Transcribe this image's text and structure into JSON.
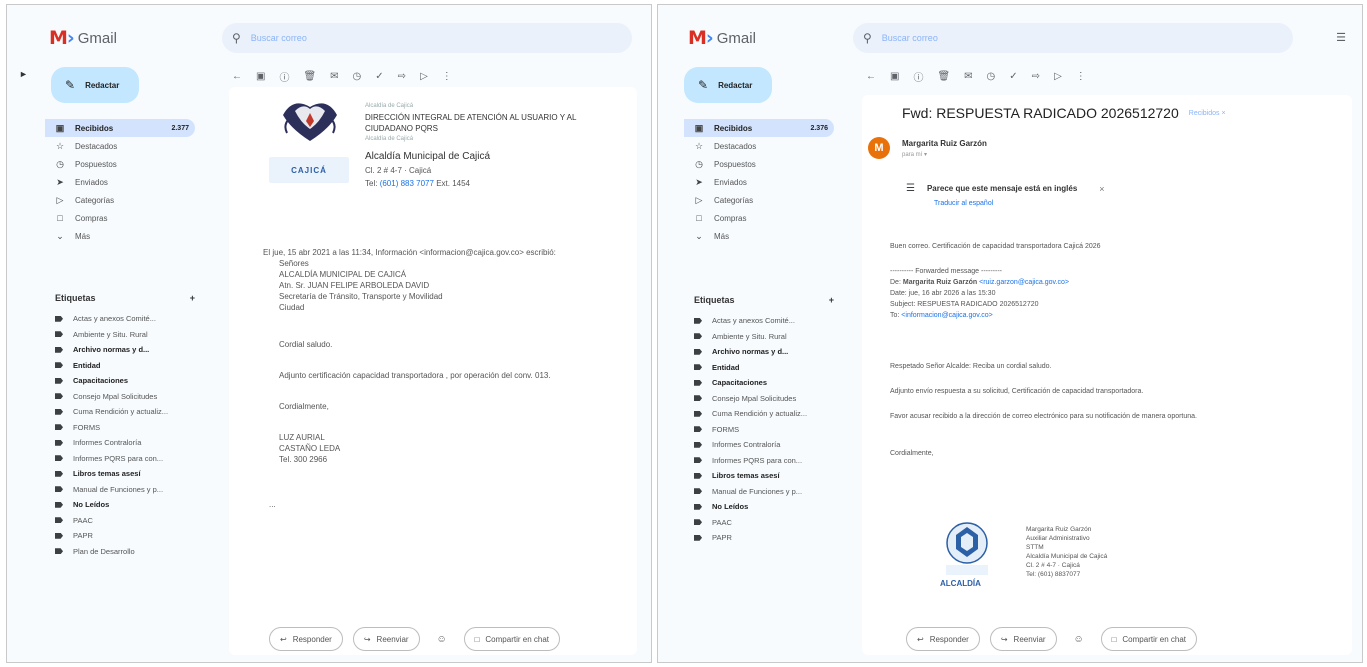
{
  "left": {
    "app_name": "Gmail",
    "search_placeholder": "Buscar correo",
    "compose_label": "Redactar",
    "nav": [
      {
        "label": "Recibidos",
        "count": "2.377",
        "icon": "inbox-icon"
      },
      {
        "label": "Destacados",
        "icon": "star-icon"
      },
      {
        "label": "Pospuestos",
        "icon": "clock-icon"
      },
      {
        "label": "Enviados",
        "icon": "send-icon"
      },
      {
        "label": "Categorías",
        "icon": "label-icon"
      },
      {
        "label": "Compras",
        "icon": "cart-icon"
      },
      {
        "label": "Más",
        "icon": "chevron-down-icon"
      }
    ],
    "labels_title": "Etiquetas",
    "labels_add": "+",
    "labels": [
      {
        "label": "Actas y anexos Comité...",
        "bold": false
      },
      {
        "label": "Ambiente y Situ. Rural",
        "bold": false
      },
      {
        "label": "Archivo normas y d...",
        "bold": true
      },
      {
        "label": "Entidad",
        "bold": true
      },
      {
        "label": "Capacitaciones",
        "bold": true
      },
      {
        "label": "Consejo Mpal Solicitudes",
        "bold": false
      },
      {
        "label": "Cuma Rendición y actualiz...",
        "bold": false
      },
      {
        "label": "FORMS",
        "bold": false
      },
      {
        "label": "Informes Contraloría",
        "bold": false
      },
      {
        "label": "Informes PQRS para con...",
        "bold": false
      },
      {
        "label": "Libros temas asesí",
        "bold": true
      },
      {
        "label": "Manual de Funciones y p...",
        "bold": false
      },
      {
        "label": "No Leídos",
        "bold": true
      },
      {
        "label": "PAAC",
        "bold": false
      },
      {
        "label": "PAPR",
        "bold": false
      },
      {
        "label": "Plan de Desarrollo",
        "bold": false
      }
    ],
    "signature": {
      "office_small": "Alcaldía de Cajicá",
      "office_title": "DIRECCIÓN INTEGRAL DE ATENCIÓN AL USUARIO Y AL CIUDADANO PQRS",
      "office_sub": "Alcaldía de Cajicá",
      "seal_text": "CAJICÁ",
      "org": "Alcaldía Municipal de Cajicá",
      "address": "Cl. 2 # 4-7 · Cajicá",
      "tel_label": "Tel:",
      "tel_value": "(601) 883 7077",
      "ext": "Ext. 1454"
    },
    "body_lines": [
      "El jue, 15 abr 2021 a las 11:34, Información <informacion@cajica.gov.co> escribió:",
      "Señores",
      "ALCALDÍA MUNICIPAL DE CAJICÁ",
      "Atn. Sr. JUAN FELIPE ARBOLEDA DAVID",
      "Secretaría de Tránsito, Transporte y Movilidad",
      "Ciudad"
    ],
    "greeting": "Cordial saludo.",
    "request": "Adjunto certificación capacidad transportadora , por operación del conv. 013.",
    "closing": "Cordialmente,",
    "sig_lines": [
      "LUZ AURIAL",
      "CASTAÑO LEDA",
      "Tel. 300 2966"
    ],
    "ellipsis": "...",
    "reply_label": "Responder",
    "forward_label": "Reenviar",
    "chat_label": "Compartir en chat"
  },
  "right": {
    "app_name": "Gmail",
    "search_placeholder": "Buscar correo",
    "compose_label": "Redactar",
    "nav": [
      {
        "label": "Recibidos",
        "count": "2.376",
        "icon": "inbox-icon"
      },
      {
        "label": "Destacados",
        "icon": "star-icon"
      },
      {
        "label": "Pospuestos",
        "icon": "clock-icon"
      },
      {
        "label": "Enviados",
        "icon": "send-icon"
      },
      {
        "label": "Categorías",
        "icon": "label-icon"
      },
      {
        "label": "Compras",
        "icon": "cart-icon"
      },
      {
        "label": "Más",
        "icon": "chevron-down-icon"
      }
    ],
    "labels_title": "Etiquetas",
    "labels_add": "+",
    "labels": [
      {
        "label": "Actas y anexos Comité...",
        "bold": false
      },
      {
        "label": "Ambiente y Situ. Rural",
        "bold": false
      },
      {
        "label": "Archivo normas y d...",
        "bold": true
      },
      {
        "label": "Entidad",
        "bold": true
      },
      {
        "label": "Capacitaciones",
        "bold": true
      },
      {
        "label": "Consejo Mpal Solicitudes",
        "bold": false
      },
      {
        "label": "Cuma Rendición y actualiz...",
        "bold": false
      },
      {
        "label": "FORMS",
        "bold": false
      },
      {
        "label": "Informes Contraloría",
        "bold": false
      },
      {
        "label": "Informes PQRS para con...",
        "bold": false
      },
      {
        "label": "Libros temas asesí",
        "bold": true
      },
      {
        "label": "Manual de Funciones y p...",
        "bold": false
      },
      {
        "label": "No Leídos",
        "bold": true
      },
      {
        "label": "PAAC",
        "bold": false
      },
      {
        "label": "PAPR",
        "bold": false
      }
    ],
    "subject": "Fwd: RESPUESTA RADICADO 2026512720",
    "subject_tag": "Recibidos ×",
    "sender": "Margarita Ruiz Garzón",
    "sender_initial": "M",
    "sender_to": "para mí ▾",
    "translate_title": "Parece que este mensaje está en inglés",
    "translate_link": "Traducir al español",
    "intro": "Buen correo. Certificación de capacidad transportadora Cajicá 2026",
    "fwd_header": "---------- Forwarded message ---------",
    "fwd_from_label": "De:",
    "fwd_from": "Margarita Ruiz Garzón",
    "fwd_from_mail": "<ruiz.garzon@cajica.gov.co>",
    "fwd_date": "Date: jue, 16 abr 2026 a las 15:30",
    "fwd_subject": "Subject: RESPUESTA RADICADO 2026512720",
    "fwd_to_label": "To:",
    "fwd_to": "<informacion@cajica.gov.co>",
    "greeting": "Respetado Señor Alcalde: Reciba un cordial saludo.",
    "para1": "Adjunto envío respuesta a su solicitud, Certificación de capacidad transportadora.",
    "para2": "Favor acusar recibido a la dirección de correo electrónico para su notificación de manera oportuna.",
    "closing": "Cordialmente,",
    "sig_logo_text": "ALCALDÍA",
    "sig_lines": [
      "Margarita Ruiz Garzón",
      "Auxiliar Administrativo",
      "STTM",
      "Alcaldía Municipal de Cajicá",
      "Cl. 2 # 4-7 · Cajicá",
      "Tel: (601) 8837077"
    ],
    "reply_label": "Responder",
    "forward_label": "Reenviar",
    "chat_label": "Compartir en chat"
  },
  "colors": {
    "accent": "#c2e7ff",
    "active_nav": "#d3e3fd",
    "link": "#1a73e8",
    "avatar": "#e8710a"
  }
}
